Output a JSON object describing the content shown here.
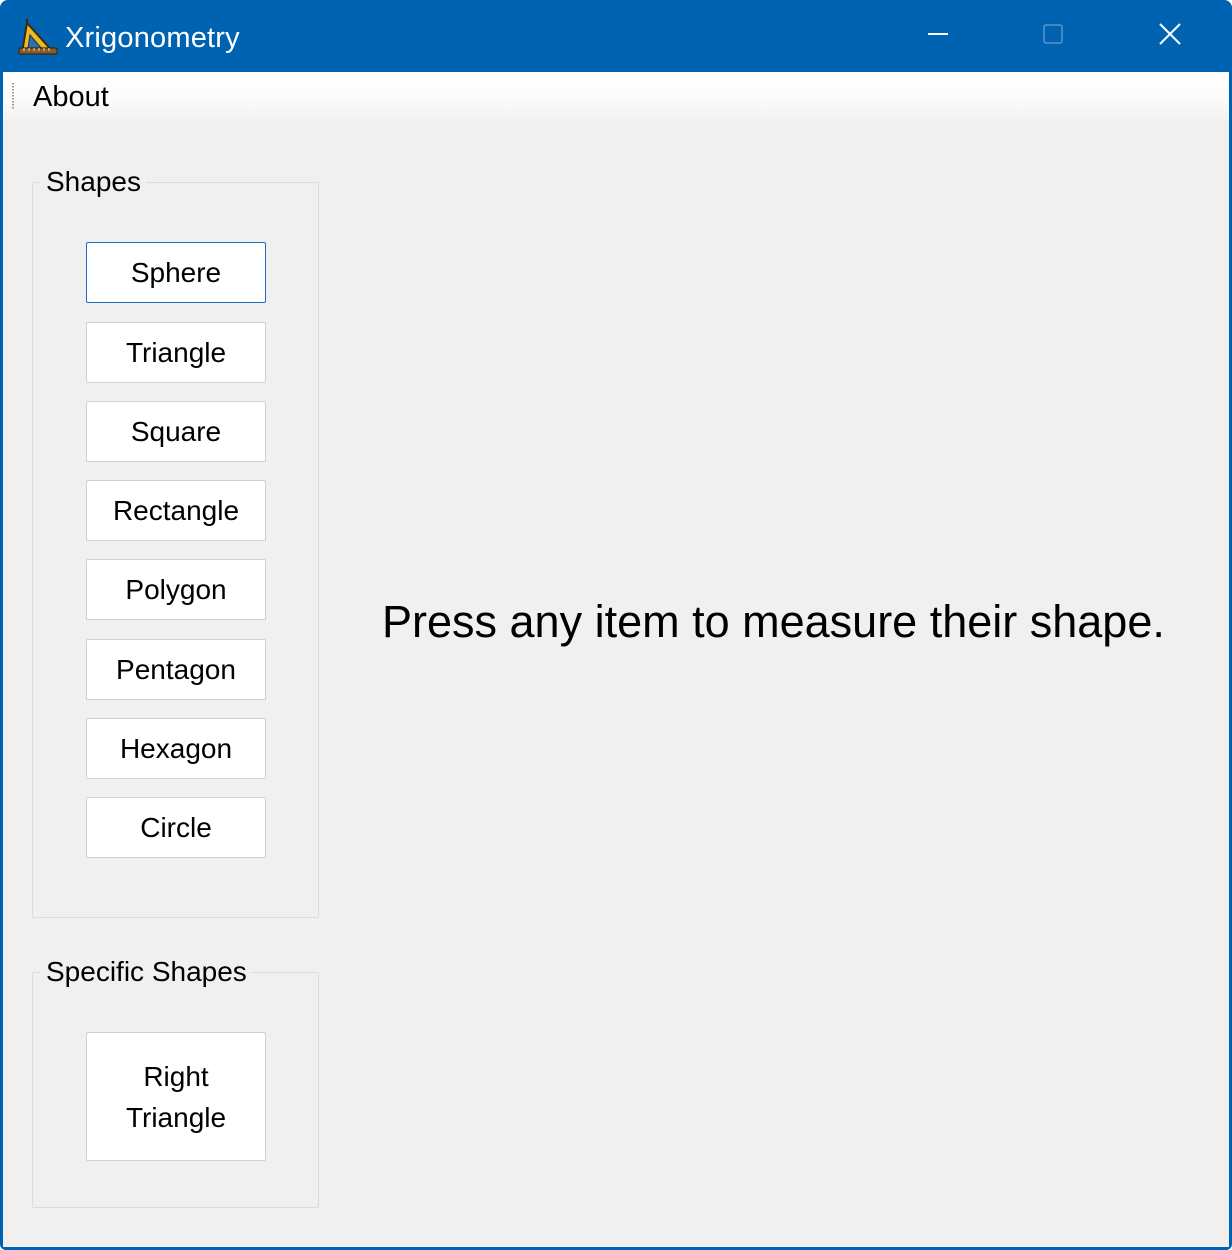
{
  "window": {
    "title": "Xrigonometry",
    "app_icon": "triangle-ruler-app-icon",
    "controls": {
      "minimize_icon": "minimize-icon",
      "maximize_icon": "maximize-icon",
      "close_icon": "close-icon"
    }
  },
  "menu": {
    "items": [
      {
        "label": "About"
      }
    ]
  },
  "shapes_group": {
    "legend": "Shapes",
    "buttons": [
      {
        "label": "Sphere"
      },
      {
        "label": "Triangle"
      },
      {
        "label": "Square"
      },
      {
        "label": "Rectangle"
      },
      {
        "label": "Polygon"
      },
      {
        "label": "Pentagon"
      },
      {
        "label": "Hexagon"
      },
      {
        "label": "Circle"
      }
    ]
  },
  "specific_group": {
    "legend": "Specific Shapes",
    "buttons": [
      {
        "label": "Right\nTriangle"
      }
    ]
  },
  "main": {
    "prompt": "Press any item to measure their shape."
  },
  "colors": {
    "titlebar": "#0063b1",
    "client_background": "#f0f0f0",
    "button_background": "#ffffff",
    "focus_border": "#1a6fc4"
  }
}
